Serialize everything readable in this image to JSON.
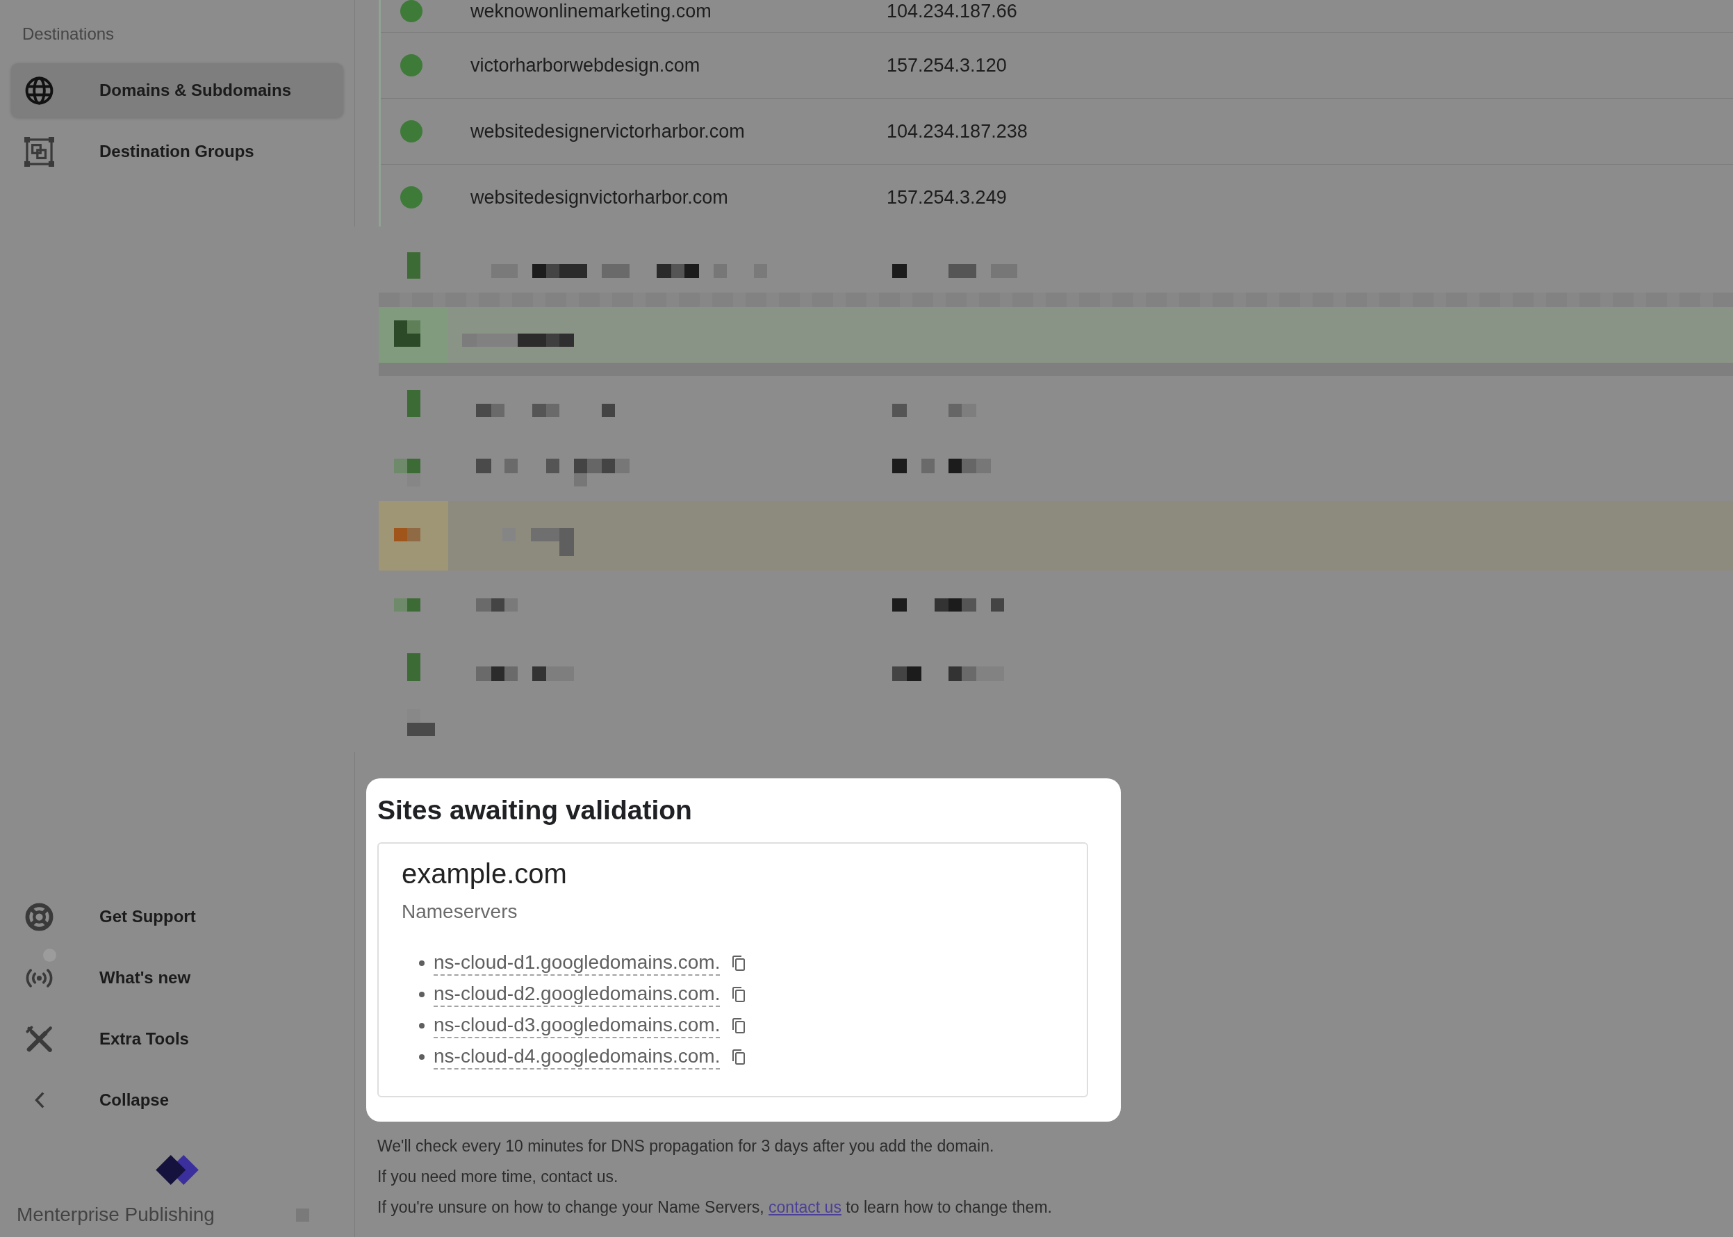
{
  "sidebar": {
    "section_label": "Destinations",
    "items": [
      {
        "label": "Domains & Subdomains",
        "selected": true
      },
      {
        "label": "Destination Groups",
        "selected": false
      }
    ],
    "footer_items": [
      {
        "label": "Get Support",
        "unread": false
      },
      {
        "label": "What's new",
        "unread": true
      },
      {
        "label": "Extra Tools",
        "unread": false
      },
      {
        "label": "Collapse",
        "unread": false
      }
    ],
    "brand": "Menterprise Publishing"
  },
  "table": {
    "rows": [
      {
        "domain": "weknowonlinemarketing.com",
        "ip": "104.234.187.66"
      },
      {
        "domain": "victorharborwebdesign.com",
        "ip": "157.254.3.120"
      },
      {
        "domain": "websitedesignervictorharbor.com",
        "ip": "104.234.187.238"
      },
      {
        "domain": "websitedesignvictorharbor.com",
        "ip": "157.254.3.249"
      }
    ]
  },
  "validation": {
    "title": "Sites awaiting validation",
    "sites": [
      {
        "domain": "example.com",
        "label": "Nameservers",
        "nameservers": [
          "ns-cloud-d1.googledomains.com.",
          "ns-cloud-d2.googledomains.com.",
          "ns-cloud-d3.googledomains.com.",
          "ns-cloud-d4.googledomains.com."
        ]
      }
    ]
  },
  "notes": [
    {
      "text": "We'll check every 10 minutes for DNS propagation for 3 days after you add the domain."
    },
    {
      "text": "If you need more time, contact us."
    },
    {
      "text": "If you're unsure on how to change your Name Servers, ",
      "link": "contact us",
      "after": " to learn how to change them."
    }
  ]
}
